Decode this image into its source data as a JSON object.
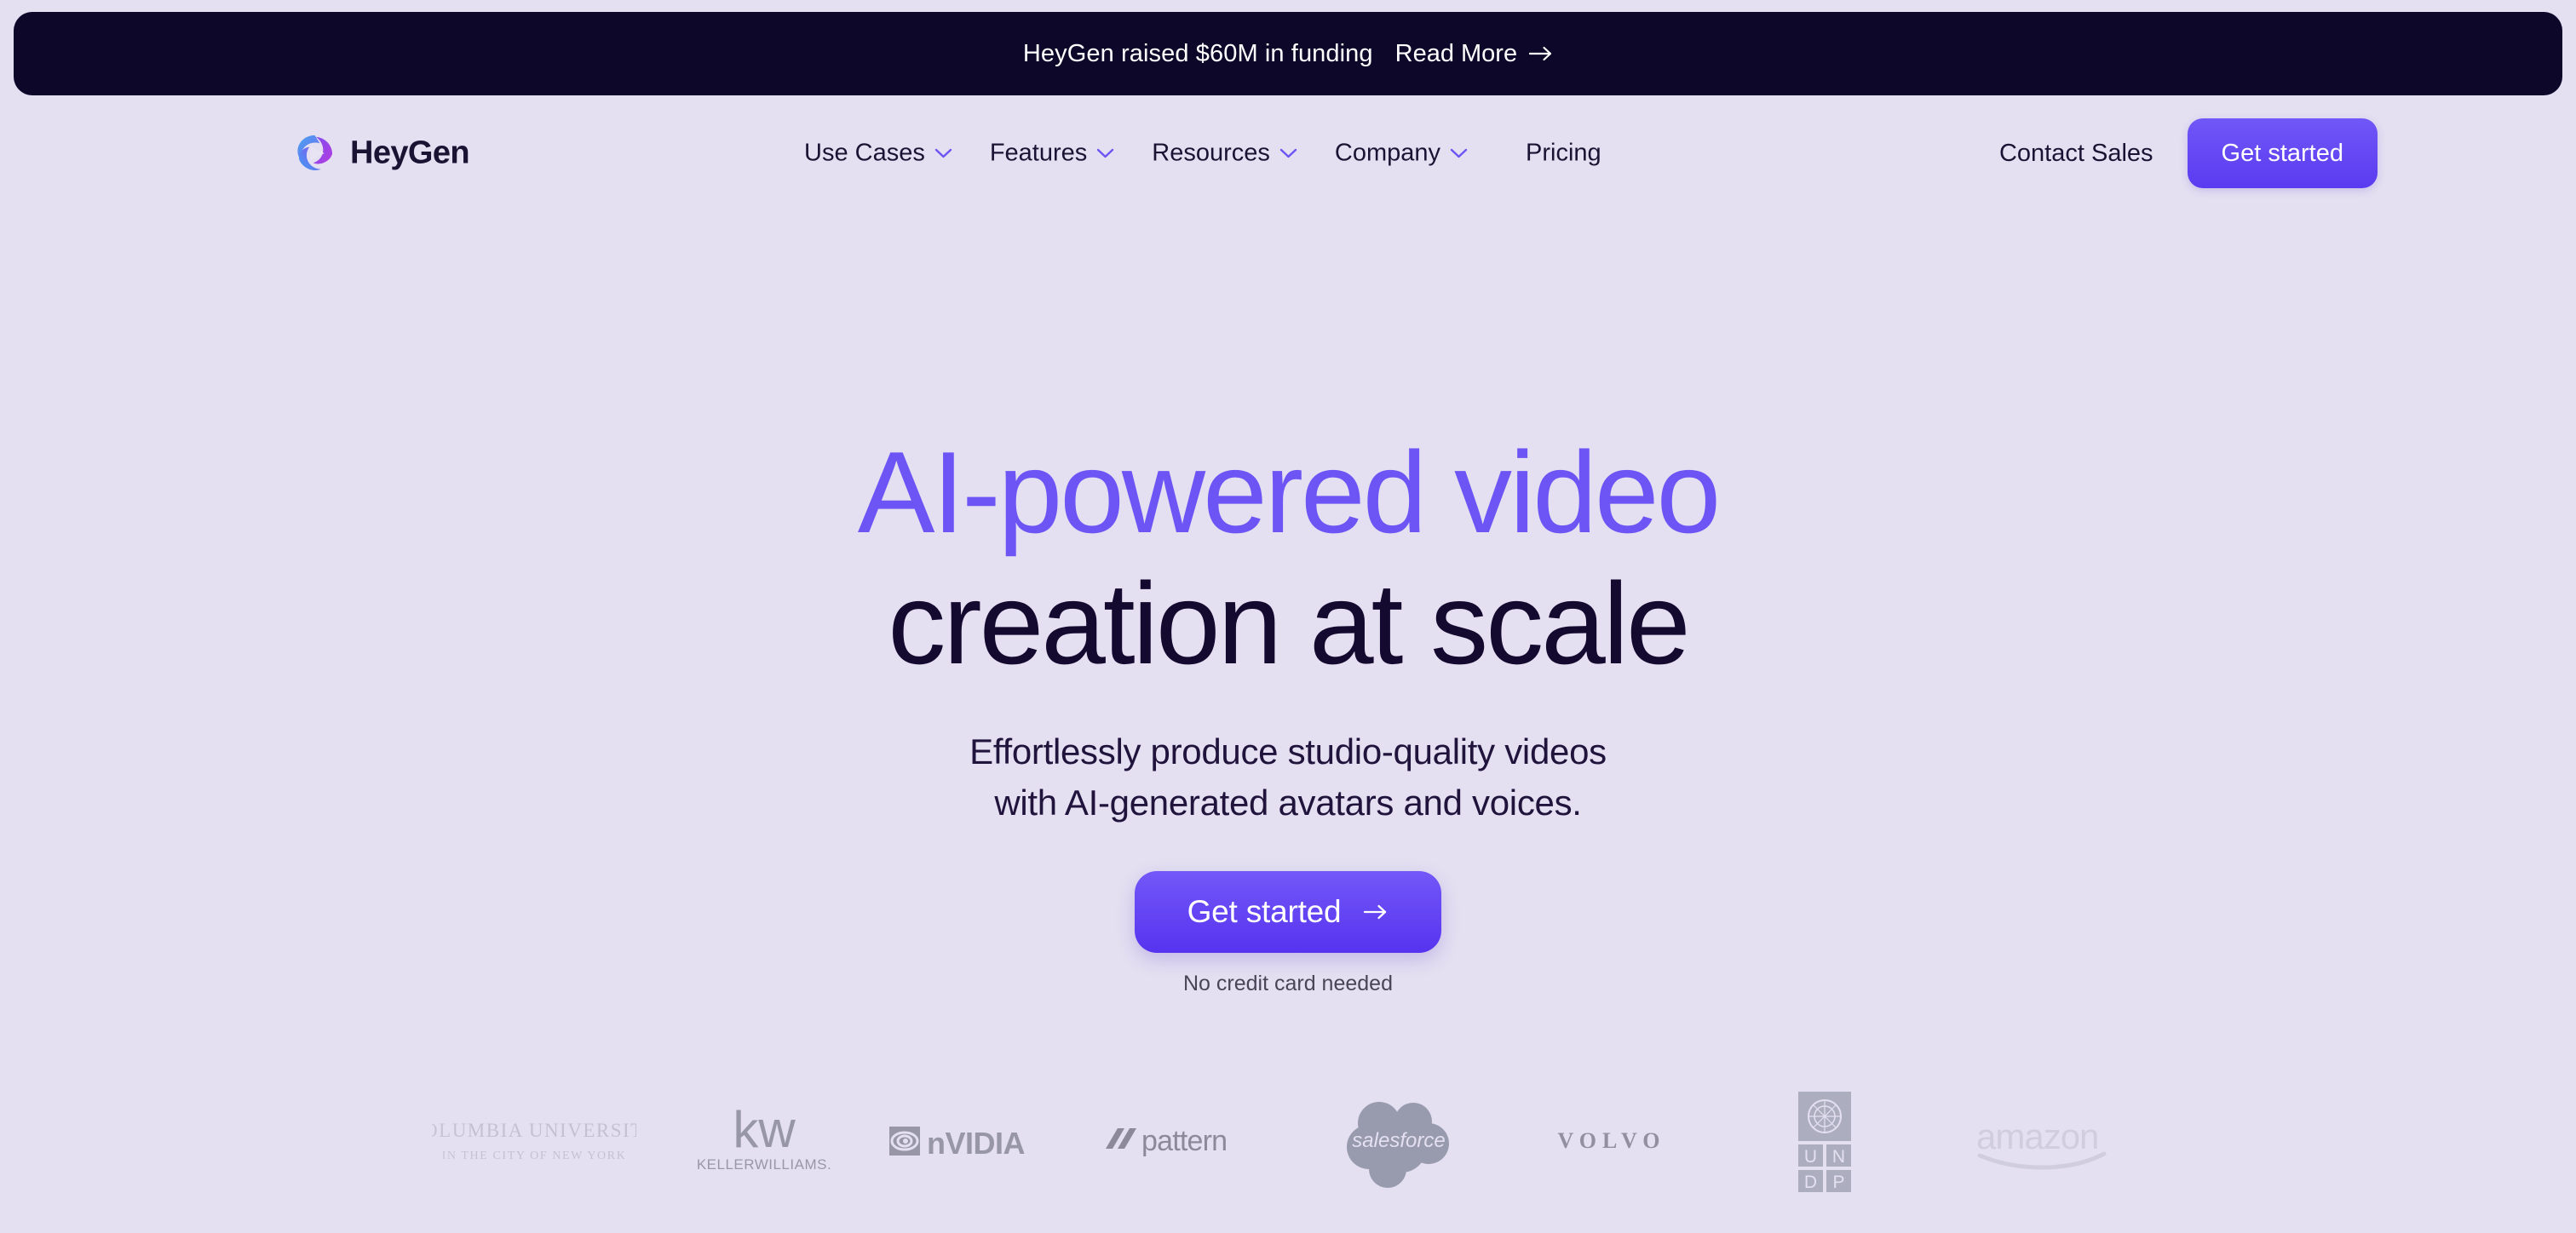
{
  "banner": {
    "message": "HeyGen raised $60M in funding",
    "link_label": "Read More",
    "arrow_icon": "arrow-right-icon",
    "background": "#0d0729",
    "text_color": "#ffffff"
  },
  "nav": {
    "brand": {
      "name": "HeyGen",
      "logo_icon": "heygen-swirl-logo"
    },
    "items": [
      {
        "label": "Use Cases",
        "has_dropdown": true,
        "chevron_icon": "chevron-down-icon"
      },
      {
        "label": "Features",
        "has_dropdown": true,
        "chevron_icon": "chevron-down-icon"
      },
      {
        "label": "Resources",
        "has_dropdown": true,
        "chevron_icon": "chevron-down-icon"
      },
      {
        "label": "Company",
        "has_dropdown": true,
        "chevron_icon": "chevron-down-icon"
      },
      {
        "label": "Pricing",
        "has_dropdown": false,
        "chevron_icon": ""
      }
    ],
    "contact_sales_label": "Contact Sales",
    "cta_label": "Get started",
    "cta_color": "#6146f2",
    "chevron_color": "#6d55f5",
    "text_color": "#1b1333"
  },
  "hero": {
    "headline_line1": "AI-powered video",
    "headline_line2": "creation at scale",
    "headline_line1_color": "#6d55f5",
    "headline_line2_color": "#140a30",
    "subhead_line1": "Effortlessly produce studio-quality videos",
    "subhead_line2": "with AI-generated avatars and voices.",
    "cta_label": "Get started",
    "cta_arrow_icon": "arrow-right-icon",
    "cta_color": "#6146f2",
    "no_credit_card": "No credit card needed"
  },
  "logos": {
    "items": [
      {
        "name": "Columbia University",
        "icon": "columbia-university-logo",
        "sub": "IN THE CITY OF NEW YORK",
        "opacity": 0.18
      },
      {
        "name": "Keller Williams",
        "icon": "keller-williams-logo",
        "sub": "KELLERWILLIAMS.",
        "opacity": 0.62
      },
      {
        "name": "NVIDIA",
        "icon": "nvidia-logo",
        "sub": "",
        "opacity": 0.62
      },
      {
        "name": "Pattern",
        "icon": "pattern-logo",
        "sub": "",
        "opacity": 0.62
      },
      {
        "name": "Salesforce",
        "icon": "salesforce-logo",
        "sub": "",
        "opacity": 0.62
      },
      {
        "name": "Volvo",
        "icon": "volvo-logo",
        "sub": "",
        "opacity": 0.62
      },
      {
        "name": "UNDP",
        "icon": "undp-logo",
        "sub": "",
        "opacity": 0.62
      },
      {
        "name": "Amazon",
        "icon": "amazon-logo",
        "sub": "",
        "opacity": 0.14
      }
    ]
  },
  "theme": {
    "page_background": "#e4e0f1",
    "accent": "#6d55f5",
    "dark": "#0d0729"
  }
}
